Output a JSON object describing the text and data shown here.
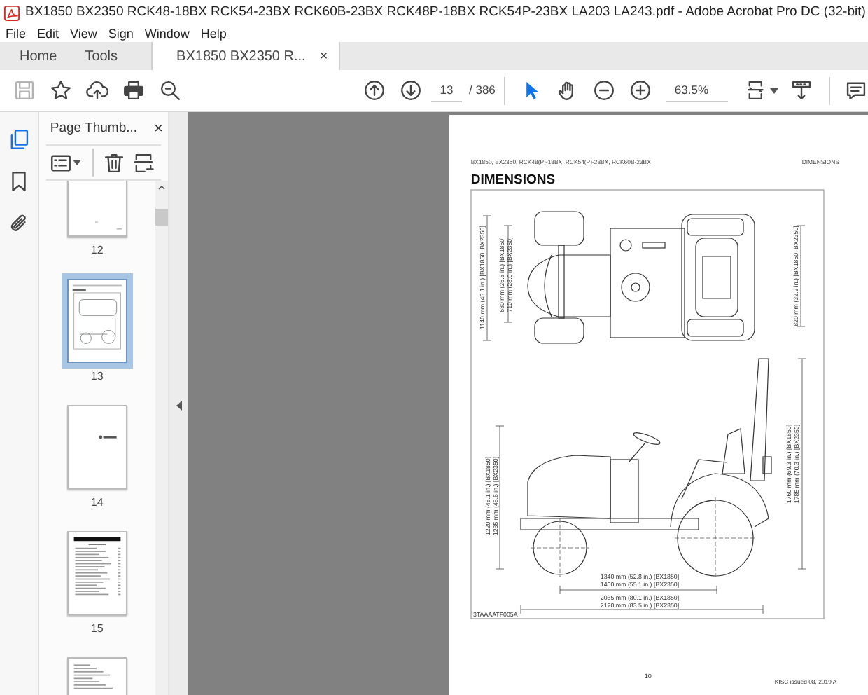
{
  "window": {
    "title": "BX1850 BX2350 RCK48-18BX RCK54-23BX RCK60B-23BX RCK48P-18BX RCK54P-23BX LA203 LA243.pdf - Adobe Acrobat Pro DC (32-bit)"
  },
  "menu": [
    "File",
    "Edit",
    "View",
    "Sign",
    "Window",
    "Help"
  ],
  "tabs": [
    {
      "label": "Home",
      "selected": false
    },
    {
      "label": "Tools",
      "selected": false
    },
    {
      "label": "BX1850 BX2350 R...",
      "selected": true,
      "close": "×"
    }
  ],
  "toolbar": {
    "left": [
      {
        "kind": "save",
        "disabled": true
      },
      {
        "kind": "star",
        "disabled": false
      },
      {
        "kind": "upload",
        "disabled": false
      },
      {
        "kind": "print",
        "disabled": false
      },
      {
        "kind": "find",
        "disabled": false
      }
    ],
    "nav": [
      {
        "kind": "prev"
      },
      {
        "kind": "next"
      }
    ],
    "page": "13",
    "page_total": "/ 386",
    "tools": [
      {
        "kind": "select",
        "selected": true
      },
      {
        "kind": "hand",
        "selected": false
      }
    ],
    "zoom_buttons": [
      {
        "kind": "zoom-out"
      },
      {
        "kind": "zoom-in"
      }
    ],
    "zoom": "63.5%",
    "view": [
      {
        "kind": "fit"
      },
      {
        "kind": "scroll"
      },
      {
        "kind": "comment"
      }
    ]
  },
  "side_nav": [
    {
      "kind": "pages",
      "selected": true
    },
    {
      "kind": "bookmarks",
      "selected": false
    },
    {
      "kind": "attachments",
      "selected": false
    }
  ],
  "panel": {
    "title": "Page Thumb...",
    "close": "×",
    "thumbnails": [
      {
        "label": "12",
        "kind": "blank",
        "selected": false
      },
      {
        "label": "13",
        "kind": "figure",
        "selected": true
      },
      {
        "label": "14",
        "kind": "logo",
        "selected": false
      },
      {
        "label": "15",
        "kind": "contents",
        "selected": false
      },
      {
        "kind": "text",
        "selected": false
      }
    ]
  },
  "document": {
    "header_left": "BX1850, BX2350, RCK48(P)-18BX, RCK54(P)-23BX, RCK60B-23BX",
    "header_right": "DIMENSIONS",
    "title": "DIMENSIONS",
    "top_view_labels": [
      "1140 mm (45.1 in.) [BX1850, BX2350]",
      "680 mm (26.8 in.) [BX1850]",
      "710 mm (28.0 in.) [BX2350]",
      "820 mm (32.2 in.) [BX1850, BX2350]"
    ],
    "side_view_labels": [
      "1220 mm (48.1 in.) [BX1850]",
      "1235 mm (48.6 in.) [BX2350]",
      "1760 mm (69.3 in.) [BX1850]",
      "1785 mm (70.3 in.) [BX2350]",
      "1340 mm (52.8 in.) [BX1850]",
      "1400 mm (55.1 in.) [BX2350]",
      "2035 mm (80.1 in.) [BX1850]",
      "2120 mm (83.5 in.) [BX2350]"
    ],
    "figure_code": "3TAAAATF005A",
    "page_number": "10",
    "footer": "KISC issued 08, 2019 A"
  }
}
